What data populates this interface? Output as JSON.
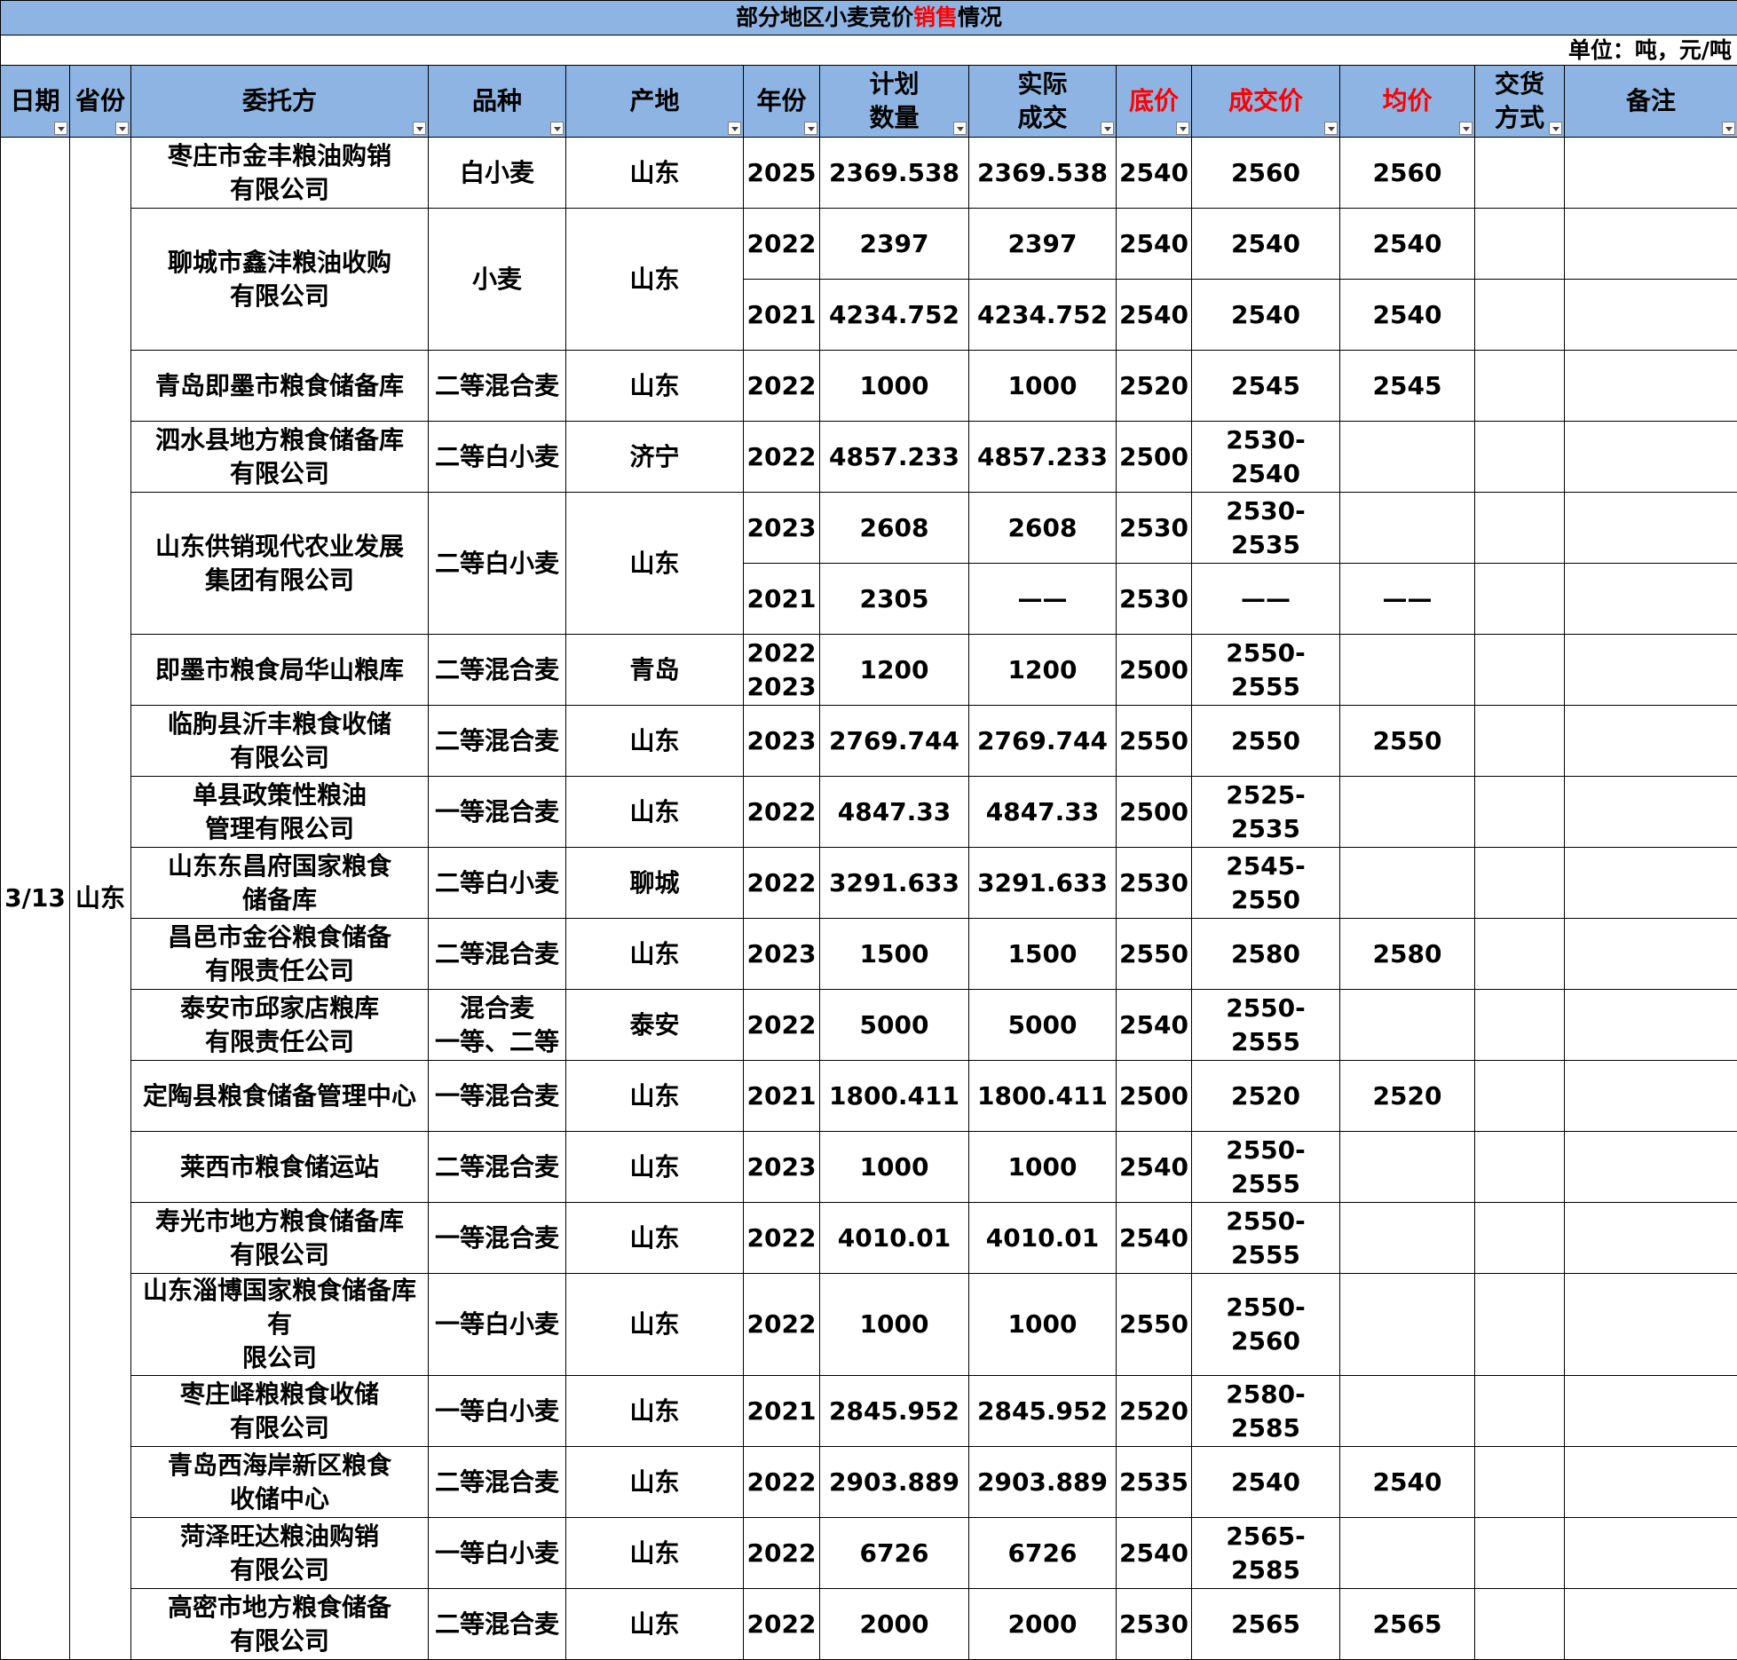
{
  "title": {
    "part1": "部分地区小麦竞价",
    "highlight": "销售",
    "part2": "情况"
  },
  "unit": "单位：吨，元/吨",
  "headers": {
    "date": "日期",
    "province": "省份",
    "entrust": "委托方",
    "variety": "品种",
    "origin": "产地",
    "year": "年份",
    "plan_l1": "计划",
    "plan_l2": "数量",
    "actual_l1": "实际",
    "actual_l2": "成交",
    "base": "底价",
    "deal": "成交价",
    "avg": "均价",
    "deliv_l1": "交货",
    "deliv_l2": "方式",
    "remark": "备注"
  },
  "colors": {
    "header_bg": "#8DB4E2",
    "price_red": "#FF0000",
    "grid": "#000000"
  },
  "icons": {
    "filter": "dropdown-filter-icon"
  },
  "date": "3/13",
  "province": "山东",
  "groups": [
    {
      "entrust": [
        "枣庄市金丰粮油购销",
        "有限公司"
      ],
      "variety": [
        "白小麦"
      ],
      "origin": "山东",
      "rows": [
        {
          "year": [
            "2025"
          ],
          "plan": "2369.538",
          "actual": "2369.538",
          "base": "2540",
          "deal": "2560",
          "avg": "2560"
        }
      ]
    },
    {
      "entrust": [
        "聊城市鑫沣粮油收购",
        "有限公司"
      ],
      "variety": [
        "小麦"
      ],
      "origin": "山东",
      "rows": [
        {
          "year": [
            "2022"
          ],
          "plan": "2397",
          "actual": "2397",
          "base": "2540",
          "deal": "2540",
          "avg": "2540"
        },
        {
          "year": [
            "2021"
          ],
          "plan": "4234.752",
          "actual": "4234.752",
          "base": "2540",
          "deal": "2540",
          "avg": "2540"
        }
      ]
    },
    {
      "entrust": [
        "青岛即墨市粮食储备库"
      ],
      "variety": [
        "二等混合麦"
      ],
      "origin": "山东",
      "rows": [
        {
          "year": [
            "2022"
          ],
          "plan": "1000",
          "actual": "1000",
          "base": "2520",
          "deal": "2545",
          "avg": "2545"
        }
      ]
    },
    {
      "entrust": [
        "泗水县地方粮食储备库",
        "有限公司"
      ],
      "variety": [
        "二等白小麦"
      ],
      "origin": "济宁",
      "rows": [
        {
          "year": [
            "2022"
          ],
          "plan": "4857.233",
          "actual": "4857.233",
          "base": "2500",
          "deal": "2530-2540",
          "avg": ""
        }
      ]
    },
    {
      "entrust": [
        "山东供销现代农业发展",
        "集团有限公司"
      ],
      "variety": [
        "二等白小麦"
      ],
      "origin": "山东",
      "rows": [
        {
          "year": [
            "2023"
          ],
          "plan": "2608",
          "actual": "2608",
          "base": "2530",
          "deal": "2530-2535",
          "avg": ""
        },
        {
          "year": [
            "2021"
          ],
          "plan": "2305",
          "actual": "——",
          "base": "2530",
          "deal": "——",
          "avg": "——"
        }
      ]
    },
    {
      "entrust": [
        "即墨市粮食局华山粮库"
      ],
      "variety": [
        "二等混合麦"
      ],
      "origin": "青岛",
      "rows": [
        {
          "year": [
            "2022",
            "2023"
          ],
          "plan": "1200",
          "actual": "1200",
          "base": "2500",
          "deal": "2550-2555",
          "avg": ""
        }
      ]
    },
    {
      "entrust": [
        "临朐县沂丰粮食收储",
        "有限公司"
      ],
      "variety": [
        "二等混合麦"
      ],
      "origin": "山东",
      "rows": [
        {
          "year": [
            "2023"
          ],
          "plan": "2769.744",
          "actual": "2769.744",
          "base": "2550",
          "deal": "2550",
          "avg": "2550"
        }
      ]
    },
    {
      "entrust": [
        "单县政策性粮油",
        "管理有限公司"
      ],
      "variety": [
        "一等混合麦"
      ],
      "origin": "山东",
      "rows": [
        {
          "year": [
            "2022"
          ],
          "plan": "4847.33",
          "actual": "4847.33",
          "base": "2500",
          "deal": "2525-2535",
          "avg": ""
        }
      ]
    },
    {
      "entrust": [
        "山东东昌府国家粮食",
        "储备库"
      ],
      "variety": [
        "二等白小麦"
      ],
      "origin": "聊城",
      "rows": [
        {
          "year": [
            "2022"
          ],
          "plan": "3291.633",
          "actual": "3291.633",
          "base": "2530",
          "deal": "2545-2550",
          "avg": ""
        }
      ]
    },
    {
      "entrust": [
        "昌邑市金谷粮食储备",
        "有限责任公司"
      ],
      "variety": [
        "二等混合麦"
      ],
      "origin": "山东",
      "rows": [
        {
          "year": [
            "2023"
          ],
          "plan": "1500",
          "actual": "1500",
          "base": "2550",
          "deal": "2580",
          "avg": "2580"
        }
      ]
    },
    {
      "entrust": [
        "泰安市邱家店粮库",
        "有限责任公司"
      ],
      "variety": [
        "混合麦",
        "一等、二等"
      ],
      "origin": "泰安",
      "rows": [
        {
          "year": [
            "2022"
          ],
          "plan": "5000",
          "actual": "5000",
          "base": "2540",
          "deal": "2550-2555",
          "avg": ""
        }
      ]
    },
    {
      "entrust": [
        "定陶县粮食储备管理中心"
      ],
      "variety": [
        "一等混合麦"
      ],
      "origin": "山东",
      "rows": [
        {
          "year": [
            "2021"
          ],
          "plan": "1800.411",
          "actual": "1800.411",
          "base": "2500",
          "deal": "2520",
          "avg": "2520"
        }
      ]
    },
    {
      "entrust": [
        "莱西市粮食储运站"
      ],
      "variety": [
        "二等混合麦"
      ],
      "origin": "山东",
      "rows": [
        {
          "year": [
            "2023"
          ],
          "plan": "1000",
          "actual": "1000",
          "base": "2540",
          "deal": "2550-2555",
          "avg": ""
        }
      ]
    },
    {
      "entrust": [
        "寿光市地方粮食储备库",
        "有限公司"
      ],
      "variety": [
        "一等混合麦"
      ],
      "origin": "山东",
      "rows": [
        {
          "year": [
            "2022"
          ],
          "plan": "4010.01",
          "actual": "4010.01",
          "base": "2540",
          "deal": "2550-2555",
          "avg": ""
        }
      ]
    },
    {
      "entrust": [
        "山东淄博国家粮食储备库有",
        "限公司"
      ],
      "variety": [
        "一等白小麦"
      ],
      "origin": "山东",
      "rows": [
        {
          "year": [
            "2022"
          ],
          "plan": "1000",
          "actual": "1000",
          "base": "2550",
          "deal": "2550-2560",
          "avg": ""
        }
      ]
    },
    {
      "entrust": [
        "枣庄峄粮粮食收储",
        "有限公司"
      ],
      "variety": [
        "一等白小麦"
      ],
      "origin": "山东",
      "rows": [
        {
          "year": [
            "2021"
          ],
          "plan": "2845.952",
          "actual": "2845.952",
          "base": "2520",
          "deal": "2580-2585",
          "avg": ""
        }
      ]
    },
    {
      "entrust": [
        "青岛西海岸新区粮食",
        "收储中心"
      ],
      "variety": [
        "二等混合麦"
      ],
      "origin": "山东",
      "rows": [
        {
          "year": [
            "2022"
          ],
          "plan": "2903.889",
          "actual": "2903.889",
          "base": "2535",
          "deal": "2540",
          "avg": "2540"
        }
      ]
    },
    {
      "entrust": [
        "菏泽旺达粮油购销",
        "有限公司"
      ],
      "variety": [
        "一等白小麦"
      ],
      "origin": "山东",
      "rows": [
        {
          "year": [
            "2022"
          ],
          "plan": "6726",
          "actual": "6726",
          "base": "2540",
          "deal": "2565-2585",
          "avg": ""
        }
      ]
    },
    {
      "entrust": [
        "高密市地方粮食储备",
        "有限公司"
      ],
      "variety": [
        "二等混合麦"
      ],
      "origin": "山东",
      "rows": [
        {
          "year": [
            "2022"
          ],
          "plan": "2000",
          "actual": "2000",
          "base": "2530",
          "deal": "2565",
          "avg": "2565"
        }
      ]
    }
  ]
}
